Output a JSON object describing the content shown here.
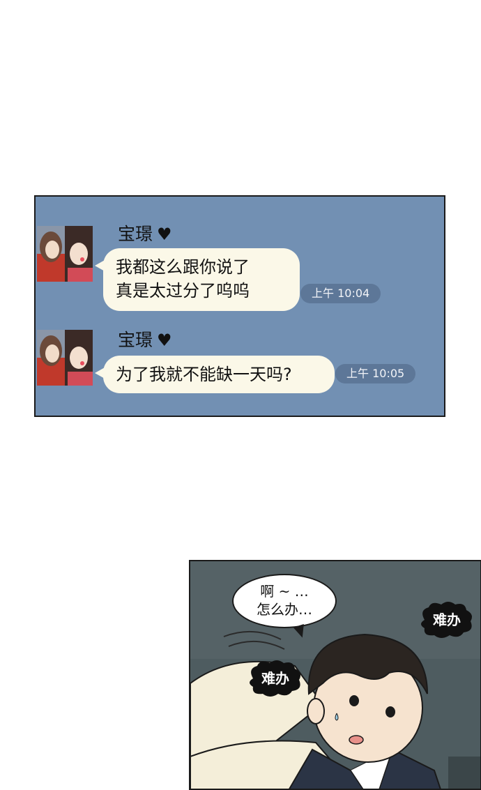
{
  "colors": {
    "chat_background": "#7290b3",
    "bubble": "#fbf8e8",
    "time_pill": "#5d7798"
  },
  "chat": {
    "messages": [
      {
        "sender": "宝璟",
        "sender_icon": "heart-icon",
        "lines": [
          "我都这么跟你说了",
          "真是太过分了呜呜"
        ],
        "time": "上午 10:04"
      },
      {
        "sender": "宝璟",
        "sender_icon": "heart-icon",
        "lines": [
          "为了我就不能缺一天吗?"
        ],
        "time": "上午 10:05"
      }
    ]
  },
  "comic": {
    "speech": [
      "啊 ~ …",
      "怎么办…"
    ],
    "sfx_right": "难办",
    "sfx_left": "难办"
  }
}
